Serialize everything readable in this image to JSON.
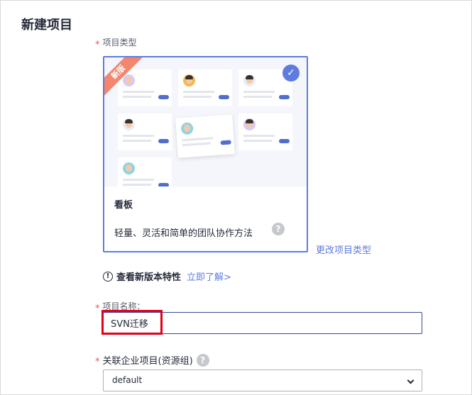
{
  "page": {
    "title": "新建项目"
  },
  "project_type": {
    "label": "项目类型",
    "required_mark": "*",
    "card": {
      "badge": "新版",
      "selected": true,
      "title": "看板",
      "description": "轻量、灵活和简单的团队协作方法",
      "help_icon": "?"
    },
    "change_link": "更改项目类型"
  },
  "version_info": {
    "icon": "!",
    "text": "查看新版本特性",
    "link": "立即了解>"
  },
  "project_name": {
    "label": "项目名称：",
    "required_mark": "*",
    "value": "SVN迁移"
  },
  "linked_project": {
    "label": "关联企业项目(资源组)",
    "required_mark": "*",
    "help_icon": "?",
    "selected_value": "default"
  },
  "colors": {
    "accent": "#5e7ce0",
    "highlight": "#e0001b",
    "required": "#e8584d"
  }
}
